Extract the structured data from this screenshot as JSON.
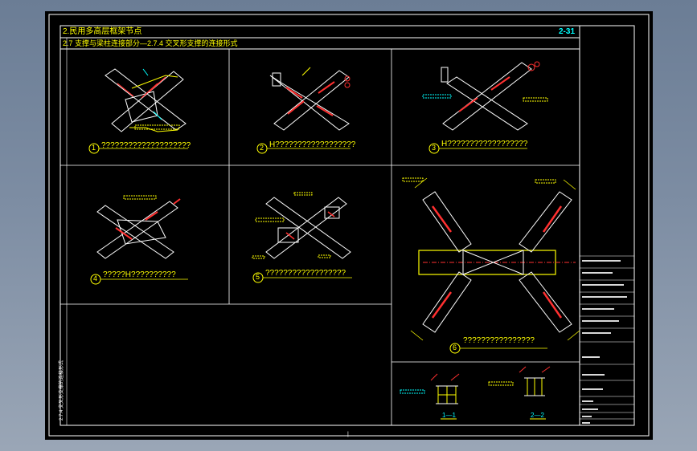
{
  "header": {
    "line1": "2.民用多高层框架节点",
    "line2": "2.7 支撑与梁柱连接部分—2.7.4 交叉形支撑的连接形式",
    "page_no": "2-31"
  },
  "details": [
    {
      "num": "1",
      "caption": "????????????????????"
    },
    {
      "num": "2",
      "caption": "H??????????????????"
    },
    {
      "num": "3",
      "caption": "H??????????????????"
    },
    {
      "num": "4",
      "caption": "?????H??????????"
    },
    {
      "num": "5",
      "caption": "??????????????????"
    },
    {
      "num": "6",
      "caption": "????????????????"
    }
  ],
  "sections": {
    "s1": "1—1",
    "s2": "2—2"
  },
  "side_note": "2.7.4 交叉形支撑的连接形式",
  "center_mark": "|",
  "colors": {
    "frame": "#ffffff",
    "text": "#ffff00",
    "member": "#ffffff",
    "bolt": "#ff3030",
    "dim": "#00ffff"
  }
}
